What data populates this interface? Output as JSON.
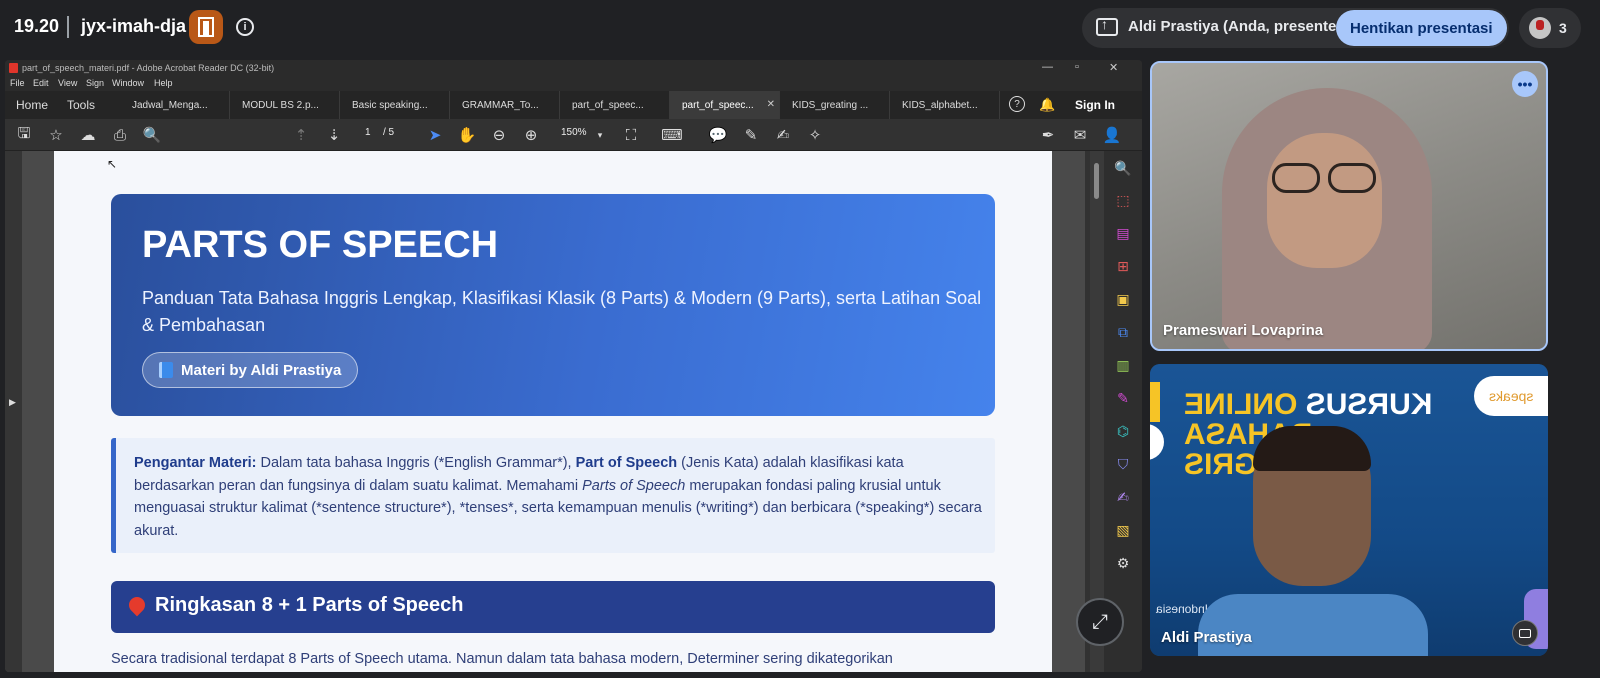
{
  "meet": {
    "time": "19.20",
    "meeting_code": "jyx-imah-dja",
    "presenter_label": "Aldi Prastiya (Anda, presenter)",
    "stop_presenting": "Hentikan presentasi",
    "participant_count": "3"
  },
  "acrobat": {
    "window_title": "part_of_speech_materi.pdf - Adobe Acrobat Reader DC (32-bit)",
    "menu": [
      "File",
      "Edit",
      "View",
      "Sign",
      "Window",
      "Help"
    ],
    "tabs": {
      "home": "Home",
      "tools": "Tools",
      "docs": [
        "Jadwal_Menga...",
        "MODUL BS 2.p...",
        "Basic speaking...",
        "GRAMMAR_To...",
        "part_of_speec...",
        "part_of_speec...",
        "KIDS_greating ...",
        "KIDS_alphabet..."
      ],
      "active_index": 5
    },
    "sign_in": "Sign In",
    "page_current": "1",
    "page_total": "/ 5",
    "zoom": "150%"
  },
  "pdf": {
    "title": "PARTS OF SPEECH",
    "subtitle": "Panduan Tata Bahasa Inggris Lengkap, Klasifikasi Klasik (8 Parts) & Modern (9 Parts), serta Latihan Soal & Pembahasan",
    "author_badge": "Materi by Aldi Prastiya",
    "intro_label": "Pengantar Materi:",
    "intro_part1": " Dalam tata bahasa Inggris (*English Grammar*), ",
    "intro_bold": "Part of Speech",
    "intro_part2": " (Jenis Kata) adalah klasifikasi kata berdasarkan peran dan fungsinya di dalam suatu kalimat. Memahami ",
    "intro_italic": "Parts of Speech",
    "intro_part3": " merupakan fondasi paling krusial untuk menguasai struktur kalimat (*sentence structure*), *tenses*, serta kemampuan menulis (*writing*) dan berbicara (*speaking*) secara akurat.",
    "summary_title": "Ringkasan 8 + 1 Parts of Speech",
    "next_line": "Secara tradisional terdapat 8 Parts of Speech utama. Namun dalam tata bahasa modern, Determiner sering dikategorikan"
  },
  "tiles": {
    "participant1": "Prameswari Lovaprina",
    "participant2": "Aldi Prastiya",
    "banner_line1a": "KURSUS ",
    "banner_line1b": "ONLINE",
    "banner_line2": "BAHASA INGGRIS",
    "banner_logo": "speaks",
    "banner_small": "Bright Speaks Indonesia"
  }
}
